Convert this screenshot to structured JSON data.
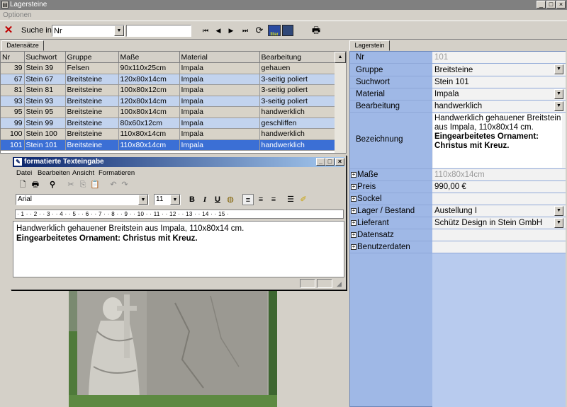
{
  "window": {
    "title": "Lagersteine",
    "minimize": "_",
    "maximize": "□",
    "close": "×"
  },
  "menu": {
    "options": "Optionen"
  },
  "toolbar": {
    "delete": "✕",
    "search_label": "Suche in:",
    "search_field": "Nr",
    "search_value": "",
    "nav_first": "⏮",
    "nav_prev": "◀",
    "nav_next": "▶",
    "nav_last": "⏭",
    "refresh": "⟳",
    "filter": "filter",
    "printer": "🖶"
  },
  "tabs": {
    "records": "Datensätze",
    "stone": "Lagerstein"
  },
  "grid": {
    "columns": [
      "Nr",
      "Suchwort",
      "Gruppe",
      "Maße",
      "Material",
      "Bearbeitung"
    ],
    "rows": [
      [
        "39",
        "Stein 39",
        "Felsen",
        "90x110x25cm",
        "Impala",
        "gehauen"
      ],
      [
        "67",
        "Stein 67",
        "Breitsteine",
        "120x80x14cm",
        "Impala",
        "3-seitig poliert"
      ],
      [
        "81",
        "Stein 81",
        "Breitsteine",
        "100x80x12cm",
        "Impala",
        "3-seitig poliert"
      ],
      [
        "93",
        "Stein 93",
        "Breitsteine",
        "120x80x14cm",
        "Impala",
        "3-seitig poliert"
      ],
      [
        "95",
        "Stein 95",
        "Breitsteine",
        "100x80x14cm",
        "Impala",
        "handwerklich"
      ],
      [
        "99",
        "Stein 99",
        "Breitsteine",
        "80x60x12cm",
        "Impala",
        "geschliffen"
      ],
      [
        "100",
        "Stein 100",
        "Breitsteine",
        "110x80x14cm",
        "Impala",
        "handwerklich"
      ],
      [
        "101",
        "Stein 101",
        "Breitsteine",
        "110x80x14cm",
        "Impala",
        "handwerklich"
      ]
    ],
    "selected_index": 7
  },
  "dialog": {
    "title": "formatierte Texteingabe",
    "menu": [
      "Datei",
      "Bearbeiten",
      "Ansicht",
      "Formatieren"
    ],
    "font": "Arial",
    "size": "11",
    "bold": "B",
    "italic": "I",
    "underline": "U",
    "ruler": "· 1 · · 2 · · 3 · · 4 · · 5 · · 6 · · 7 · · 8 · · 9 · · 10 · · 11 · · 12 · · 13 · · 14 · · 15 ·",
    "text_line1": "Handwerklich gehauener Breitstein aus Impala, 110x80x14 cm.",
    "text_line2": "Eingearbeitetes Ornament: Christus mit Kreuz."
  },
  "detail": {
    "nr_label": "Nr",
    "nr_value": "101",
    "gruppe_label": "Gruppe",
    "gruppe_value": "Breitsteine",
    "suchwort_label": "Suchwort",
    "suchwort_value": "Stein 101",
    "material_label": "Material",
    "material_value": "Impala",
    "bearbeitung_label": "Bearbeitung",
    "bearbeitung_value": "handwerklich",
    "bezeichnung_label": "Bezeichnung",
    "bezeichnung_line1": "Handwerklich gehauener Breitstein aus Impala, 110x80x14 cm.",
    "bezeichnung_line2": "Eingearbeitetes Ornament: Christus mit Kreuz.",
    "masse_label": "Maße",
    "masse_value": "110x80x14cm",
    "preis_label": "Preis",
    "preis_value": "990,00 €",
    "sockel_label": "Sockel",
    "lager_label": "Lager / Bestand",
    "lager_value": "Austellung I",
    "lieferant_label": "Lieferant",
    "lieferant_value": "Schütz Design in Stein GmbH",
    "datensatz_label": "Datensatz",
    "benutzerdaten_label": "Benutzerdaten"
  }
}
